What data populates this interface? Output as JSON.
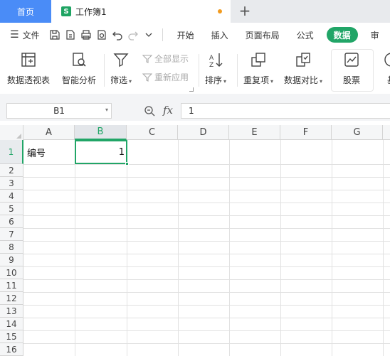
{
  "tabs": {
    "home_label": "首页",
    "doc_icon_letter": "S",
    "doc_title": "工作簿1",
    "add_label": "+"
  },
  "menubar": {
    "file_label": "文件",
    "items": [
      "开始",
      "插入",
      "页面布局",
      "公式",
      "数据",
      "审"
    ],
    "active_index": 4,
    "accent_color": "#21a567"
  },
  "ribbon": {
    "pivot_label": "数据透视表",
    "smart_analysis_label": "智能分析",
    "filter_label": "筛选",
    "show_all_label": "全部显示",
    "reapply_label": "重新应用",
    "sort_label": "排序",
    "duplicates_label": "重复项",
    "compare_label": "数据对比",
    "stock_label": "股票",
    "cut_label": "基"
  },
  "formula_bar": {
    "name_box": "B1",
    "fx_label": "fx",
    "formula_value": "1"
  },
  "sheet": {
    "columns": [
      "A",
      "B",
      "C",
      "D",
      "E",
      "F",
      "G"
    ],
    "rows": [
      "1",
      "2",
      "3",
      "4",
      "5",
      "6",
      "7",
      "8",
      "9",
      "10",
      "11",
      "12",
      "13",
      "14",
      "15",
      "16"
    ],
    "selected_cell": "B1",
    "cells": {
      "A1": "编号",
      "B1": "1"
    }
  }
}
